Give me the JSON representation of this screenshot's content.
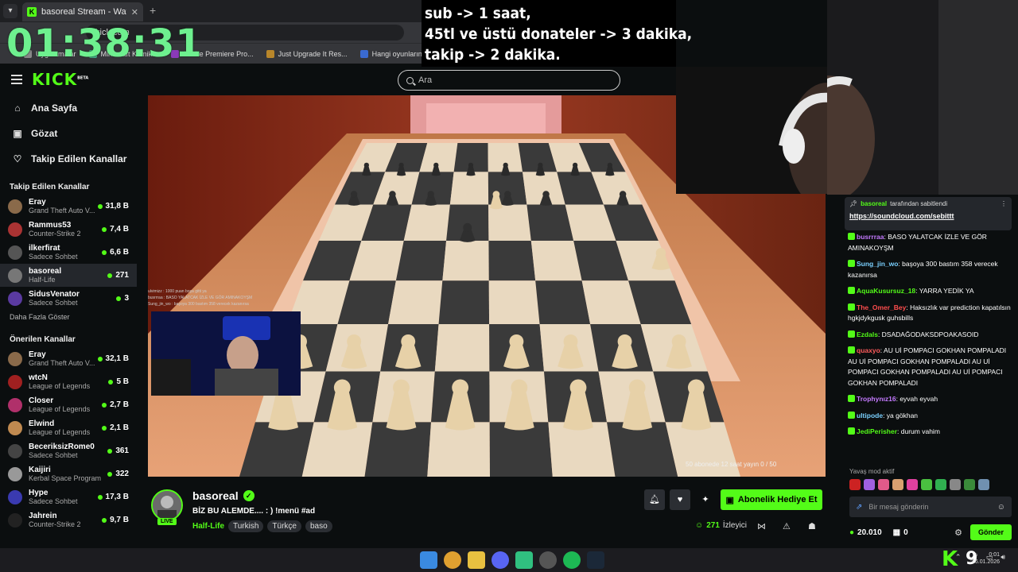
{
  "browser": {
    "tab_title": "basoreal Stream - Watch Li",
    "address": "kick.com",
    "bookmarks": [
      {
        "label": "Uygulamalar"
      },
      {
        "label": "Minecraft Komik..."
      },
      {
        "label": "Adobe Premiere Pro..."
      },
      {
        "label": "Just Upgrade It Res..."
      },
      {
        "label": "Hangi oyunların lisa..."
      }
    ]
  },
  "overlay": {
    "timer": "01:38:31",
    "info_lines": [
      "sub -> 1 saat,",
      "45tl ve üstü donateler -> 3 dakika,",
      "takip -> 2 dakika."
    ]
  },
  "header": {
    "logo": "KICK",
    "logo_badge": "BETA",
    "search_placeholder": "Ara"
  },
  "sidebar": {
    "nav": [
      {
        "label": "Ana Sayfa",
        "icon": "home-icon"
      },
      {
        "label": "Gözat",
        "icon": "browse-icon"
      },
      {
        "label": "Takip Edilen Kanallar",
        "icon": "heart-icon"
      }
    ],
    "followed_heading": "Takip Edilen Kanallar",
    "followed": [
      {
        "name": "Eray",
        "game": "Grand Theft Auto V...",
        "count": "31,8 B",
        "color": "#8a6a4a"
      },
      {
        "name": "Rammus53",
        "game": "Counter-Strike 2",
        "count": "7,4 B",
        "color": "#a33"
      },
      {
        "name": "ilkerfirat",
        "game": "Sadece Sohbet",
        "count": "6,6 B",
        "color": "#555"
      },
      {
        "name": "basoreal",
        "game": "Half-Life",
        "count": "271",
        "color": "#777"
      },
      {
        "name": "SidusVenator",
        "game": "Sadece Sohbet",
        "count": "3",
        "color": "#5a3aa0"
      }
    ],
    "more_label": "Daha Fazla Göster",
    "recommended_heading": "Önerilen Kanallar",
    "recommended": [
      {
        "name": "Eray",
        "game": "Grand Theft Auto V...",
        "count": "32,1 B",
        "color": "#8a6a4a"
      },
      {
        "name": "wtcN",
        "game": "League of Legends",
        "count": "5 B",
        "color": "#a02020"
      },
      {
        "name": "Closer",
        "game": "League of Legends",
        "count": "2,7 B",
        "color": "#b0306a"
      },
      {
        "name": "Elwind",
        "game": "League of Legends",
        "count": "2,1 B",
        "color": "#c08a50"
      },
      {
        "name": "BeceriksizRome0",
        "game": "Sadece Sohbet",
        "count": "361",
        "color": "#444"
      },
      {
        "name": "Kaijiri",
        "game": "Kerbal Space Program",
        "count": "322",
        "color": "#999"
      },
      {
        "name": "Hype",
        "game": "Sadece Sohbet",
        "count": "17,3 B",
        "color": "#3a3ab0"
      },
      {
        "name": "Jahrein",
        "game": "Counter-Strike 2",
        "count": "9,7 B",
        "color": "#222"
      }
    ]
  },
  "video": {
    "mini_chat": [
      "ulvimizz : 1000 puan boşa gitti ya",
      "busrrraa : BASO YALATCAK İZLE VE GÖR AMINAKOYŞM",
      "Sung_jin_wo : başoya 300 bastım 358 verecek kazanırsa"
    ],
    "sub_overlay": "50 abonede 12 saat yayın 0 / 50"
  },
  "stream": {
    "name": "basoreal",
    "live_label": "LIVE",
    "title": "BİZ BU ALEMDE.... : ) !menü #ad",
    "game": "Half-Life",
    "tags": [
      "Turkish",
      "Türkçe",
      "baso"
    ],
    "gift_label": "Abonelik Hediye Et",
    "viewer_count": "271",
    "viewer_label": "İzleyici"
  },
  "chat": {
    "pinned_by": "basoreal",
    "pinned_suffix": "tarafından sabitlendi",
    "pinned_link": "https://soundcloud.com/sebittt",
    "messages": [
      {
        "user": "busrrraa",
        "color": "#c47aff",
        "text": "BASO YALATCAK İZLE VE GÖR AMINAKOYŞM"
      },
      {
        "user": "Sung_jin_wo",
        "color": "#7ad0ff",
        "text": "başoya 300 bastım 358 verecek kazanırsa"
      },
      {
        "user": "AquaKusursuz_18",
        "color": "#53fc18",
        "text": "YARRA YEDİK YA"
      },
      {
        "user": "The_Omer_Bey",
        "color": "#ff4d4d",
        "text": "Haksızlık var prediction kapatılsın hgkjdykgusk guhsbills"
      },
      {
        "user": "Ezdals",
        "color": "#53fc18",
        "text": "DSADAĞODAKSDPOAKASOID"
      },
      {
        "user": "quaxyo",
        "color": "#ff5c5c",
        "text": "AU Uİ POMPACI GOKHAN POMPALADI AU Uİ POMPACI GOKHAN POMPALADI AU Uİ POMPACI GOKHAN POMPALADI AU Uİ POMPACI GOKHAN POMPALADI"
      },
      {
        "user": "Trophynız16",
        "color": "#c47aff",
        "text": "eyvah eyvah"
      },
      {
        "user": "ultipode",
        "color": "#7ad0ff",
        "text": "ya gökhan"
      },
      {
        "user": "JediPerisher",
        "color": "#53fc18",
        "text": "durum vahim"
      }
    ],
    "slow_mode": "Yavaş mod aktif",
    "input_placeholder": "Bir mesaj gönderin",
    "points": "20.010",
    "other_points": "0",
    "send_label": "Gönder"
  },
  "taskbar": {
    "k_number": "9",
    "time": "0:01",
    "date": "26.01.2026"
  }
}
